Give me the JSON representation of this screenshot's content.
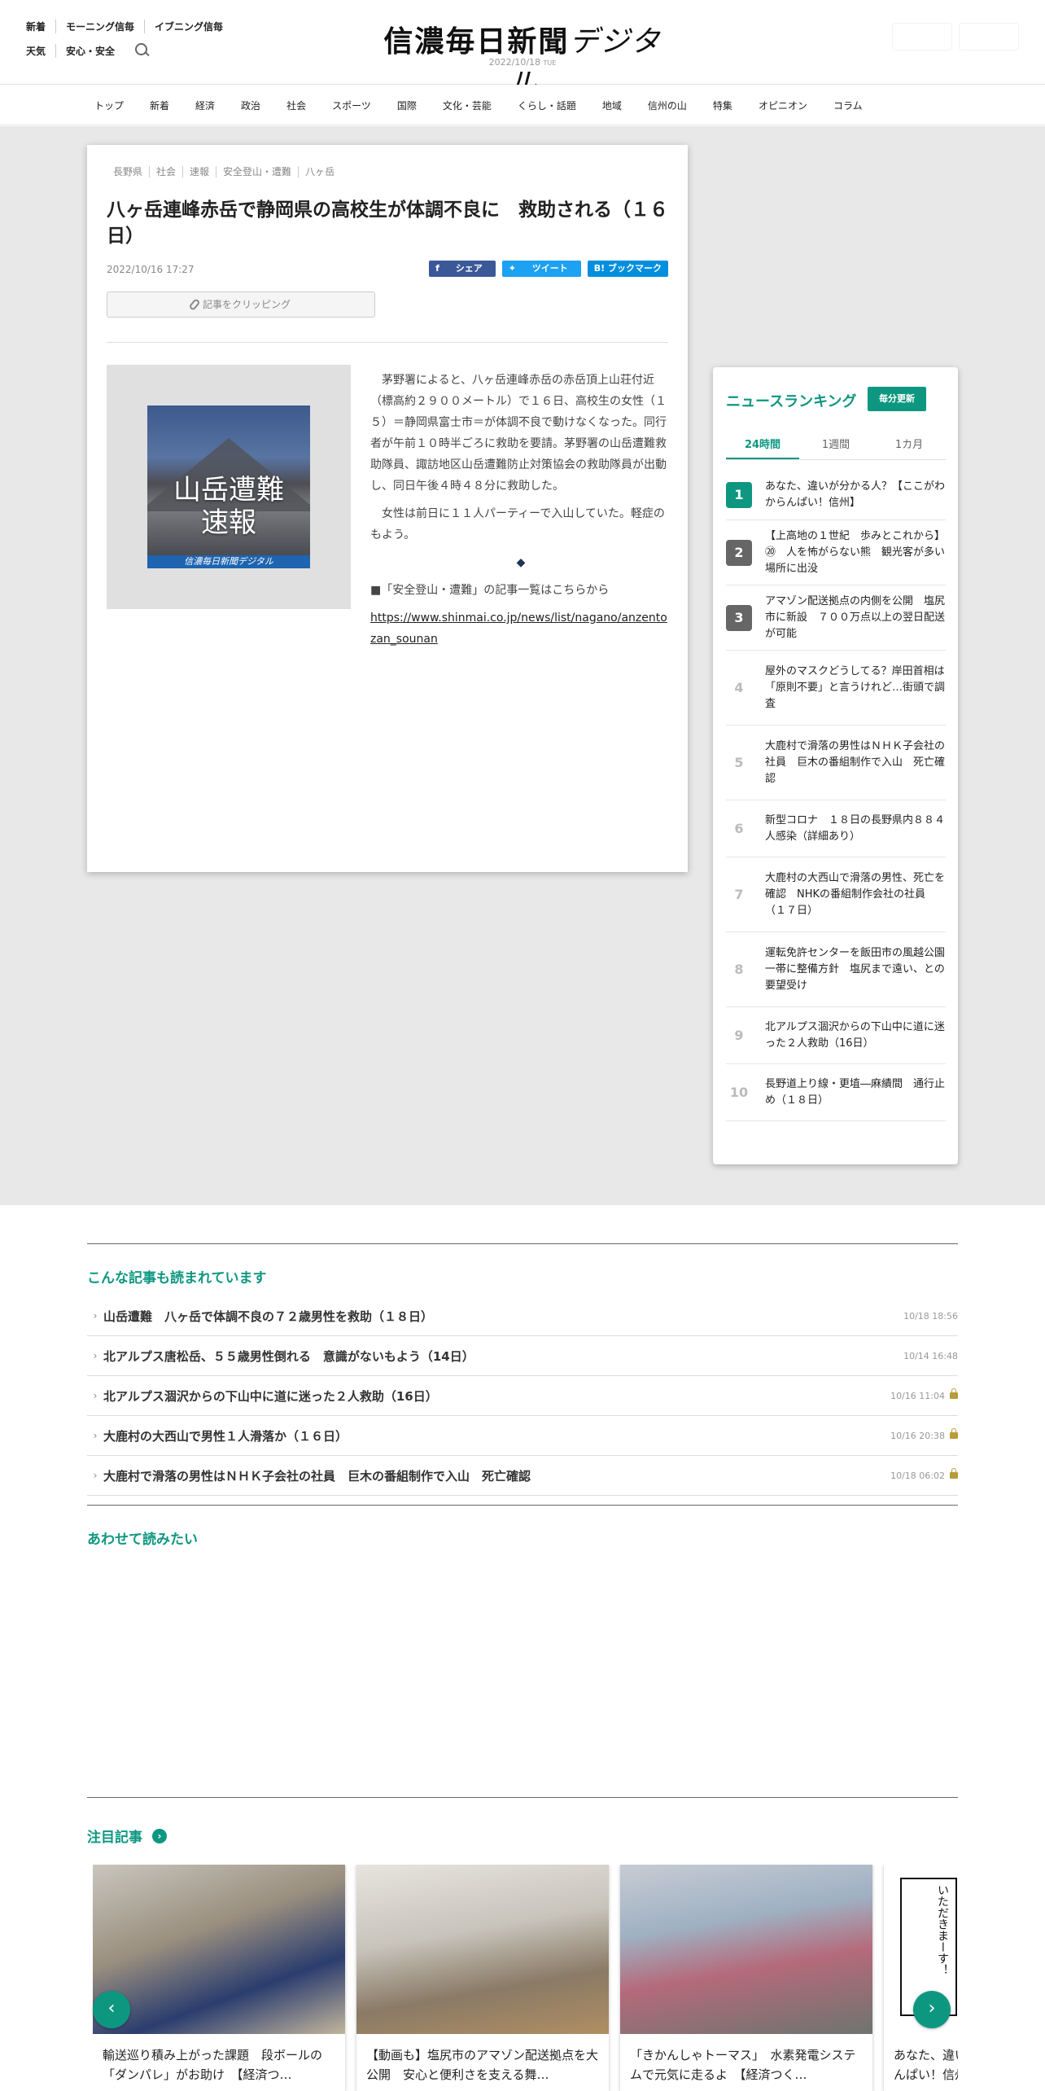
{
  "header": {
    "links_row1": [
      "新着",
      "モーニング信毎",
      "イブニング信毎"
    ],
    "links_row2": [
      "天気",
      "安心・安全"
    ],
    "logo_main": "信濃毎日新聞",
    "logo_sub": "デジタル",
    "date": "2022/10/18",
    "weekday": "TUE"
  },
  "nav": [
    "トップ",
    "新着",
    "経済",
    "政治",
    "社会",
    "スポーツ",
    "国際",
    "文化・芸能",
    "くらし・話題",
    "地域",
    "信州の山",
    "特集",
    "オピニオン",
    "コラム"
  ],
  "article": {
    "tags": [
      "長野県",
      "社会",
      "速報",
      "安全登山・遭難",
      "八ヶ岳"
    ],
    "title": "八ヶ岳連峰赤岳で静岡県の高校生が体調不良に　救助される（１６日）",
    "date": "2022/10/16 17:27",
    "share": {
      "facebook": "シェア",
      "twitter": "ツイート",
      "hatena": "B! ブックマーク"
    },
    "clip_label": "記事をクリッピング",
    "photo_text_line1": "山岳遭難",
    "photo_text_line2": "速報",
    "photo_band": "信濃毎日新聞デジタル",
    "para1": "茅野署によると、八ヶ岳連峰赤岳の赤岳頂上山荘付近（標高約２９００メートル）で１６日、高校生の女性（１５）＝静岡県富士市＝が体調不良で動けなくなった。同行者が午前１０時半ごろに救助を要請。茅野署の山岳遭難救助隊員、諏訪地区山岳遭難防止対策協会の救助隊員が出動し、同日午後４時４８分に救助した。",
    "para2": "女性は前日に１１人パーティーで入山していた。軽症のもよう。",
    "diamond": "◆",
    "list_link": "■「安全登山・遭難」の記事一覧はこちらから",
    "url": "https://www.shinmai.co.jp/news/list/nagano/anzentozan_sounan"
  },
  "ranking": {
    "title": "ニュースランキング",
    "badge": "毎分更新",
    "tabs": [
      "24時間",
      "1週間",
      "1カ月"
    ],
    "items": [
      {
        "rank": "1",
        "text": "あなた、違いが分かる人？【ここがわからんぱい！信州】"
      },
      {
        "rank": "2",
        "text": "【上高地の１世紀　歩みとこれから】⑳　人を怖がらない熊　観光客が多い場所に出没"
      },
      {
        "rank": "3",
        "text": "アマゾン配送拠点の内側を公開　塩尻市に新設　７００万点以上の翌日配送が可能"
      },
      {
        "rank": "4",
        "text": "屋外のマスクどうしてる？岸田首相は「原則不要」と言うけれど…街頭で調査"
      },
      {
        "rank": "5",
        "text": "大鹿村で滑落の男性はＮＨＫ子会社の社員　巨木の番組制作で入山　死亡確認"
      },
      {
        "rank": "6",
        "text": "新型コロナ　１８日の長野県内８８４人感染（詳細あり）"
      },
      {
        "rank": "7",
        "text": "大鹿村の大西山で滑落の男性、死亡を確認　NHKの番組制作会社の社員（１７日）"
      },
      {
        "rank": "8",
        "text": "運転免許センターを飯田市の風越公園一帯に整備方針　塩尻まで遠い、との要望受け"
      },
      {
        "rank": "9",
        "text": "北アルプス涸沢からの下山中に道に迷った２人救助（16日）"
      },
      {
        "rank": "10",
        "text": "長野道上り線・更埴―麻績間　通行止め（１８日）"
      }
    ]
  },
  "popular": {
    "title": "こんな記事も読まれています",
    "items": [
      {
        "text": "山岳遭難　八ヶ岳で体調不良の７２歳男性を救助（１８日）",
        "date": "10/18 18:56",
        "locked": false
      },
      {
        "text": "北アルプス唐松岳、５５歳男性倒れる　意識がないもよう（14日）",
        "date": "10/14 16:48",
        "locked": false
      },
      {
        "text": "北アルプス涸沢からの下山中に道に迷った２人救助（16日）",
        "date": "10/16 11:04",
        "locked": true
      },
      {
        "text": "大鹿村の大西山で男性１人滑落か（１６日）",
        "date": "10/16 20:38",
        "locked": true
      },
      {
        "text": "大鹿村で滑落の男性はＮＨＫ子会社の社員　巨木の番組制作で入山　死亡確認",
        "date": "10/18 06:02",
        "locked": true
      }
    ]
  },
  "also_read": {
    "title": "あわせて読みたい"
  },
  "featured": {
    "title": "注目記事",
    "cards": [
      {
        "text": "輸送巡り積み上がった課題　段ボールの「ダンパレ」がお助け　【経済つ…"
      },
      {
        "text": "【動画も】塩尻市のアマゾン配送拠点を大公開　安心と便利さを支える舞…"
      },
      {
        "text": "「きかんしゃトーマス」　水素発電システムで元気に走るよ　【経済つく…"
      },
      {
        "text": "あなた、違いが分かる人？【ここがわからんぱい！信州】"
      }
    ],
    "manga_text": "いただきまーす！"
  },
  "colors": {
    "accent": "#0e9780",
    "facebook": "#3b5998",
    "twitter": "#1da1f2",
    "hatena": "#008fde"
  }
}
